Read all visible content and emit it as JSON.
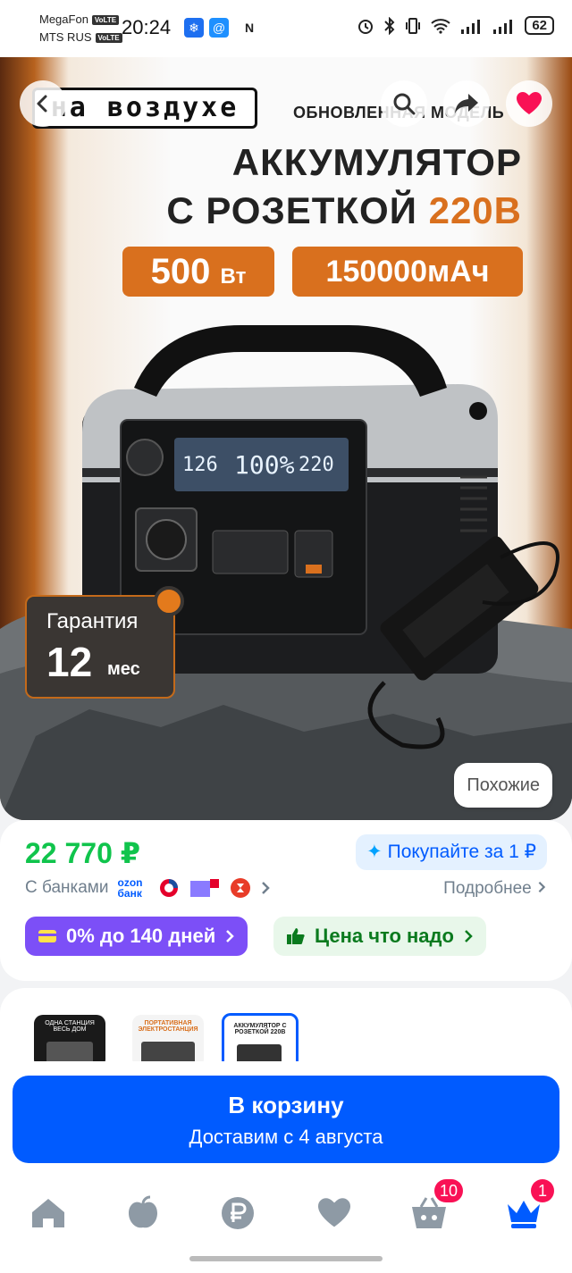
{
  "status_bar": {
    "carrier1": "MegaFon",
    "carrier2": "MTS RUS",
    "volte": "VoLTE",
    "time": "20:24",
    "battery": "62",
    "icons": [
      "snowflake-icon",
      "at-icon",
      "nfc-icon",
      "alarm-icon",
      "bluetooth-icon",
      "vibrate-icon",
      "wifi-icon",
      "signal-icon",
      "signal-icon"
    ]
  },
  "hero": {
    "brand": "на воздухе",
    "subtitle": "ОБНОВЛЕННАЯ МОДЕЛЬ",
    "title_line1": "АККУМУЛЯТОР",
    "title_line2": "С РОЗЕТКОЙ",
    "title_accent": "220В",
    "power_value": "500",
    "power_unit": "Вт",
    "capacity": "150000мАч",
    "screen_left": "126",
    "screen_center": "100%",
    "screen_right": "220",
    "warranty_label": "Гарантия",
    "warranty_value": "12",
    "warranty_unit": "мес",
    "similar_label": "Похожие",
    "accent_color": "#d9701e"
  },
  "price": {
    "value": "22 770 ₽",
    "promo": "Покупайте за 1 ₽",
    "banks_label": "С банками",
    "bank_ozon": "ozon банк",
    "details": "Подробнее",
    "installment": "0% до 140 дней",
    "fair_price": "Цена что надо",
    "price_color": "#10c44c"
  },
  "gallery": {
    "thumb1_text": "ОДНА СТАНЦИЯ ВЕСЬ ДОМ",
    "thumb2_text": "ПОРТАТИВНАЯ ЭЛЕКТРОСТАНЦИЯ",
    "thumb3_text": "АККУМУЛЯТОР С РОЗЕТКОЙ 220В"
  },
  "cart": {
    "label": "В корзину",
    "delivery": "Доставим с 4 августа",
    "button_color": "#005bff"
  },
  "nav": {
    "cart_badge": "10",
    "profile_badge": "1"
  }
}
